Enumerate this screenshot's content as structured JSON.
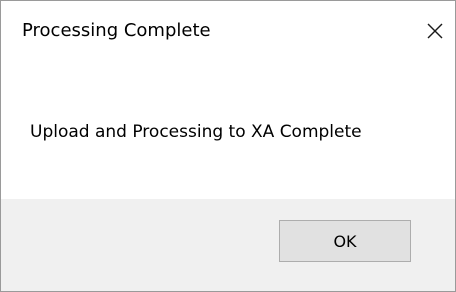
{
  "dialog": {
    "title": "Processing Complete",
    "close_icon": "close-icon",
    "message": "Upload and Processing to XA Complete",
    "ok_label": "OK"
  }
}
